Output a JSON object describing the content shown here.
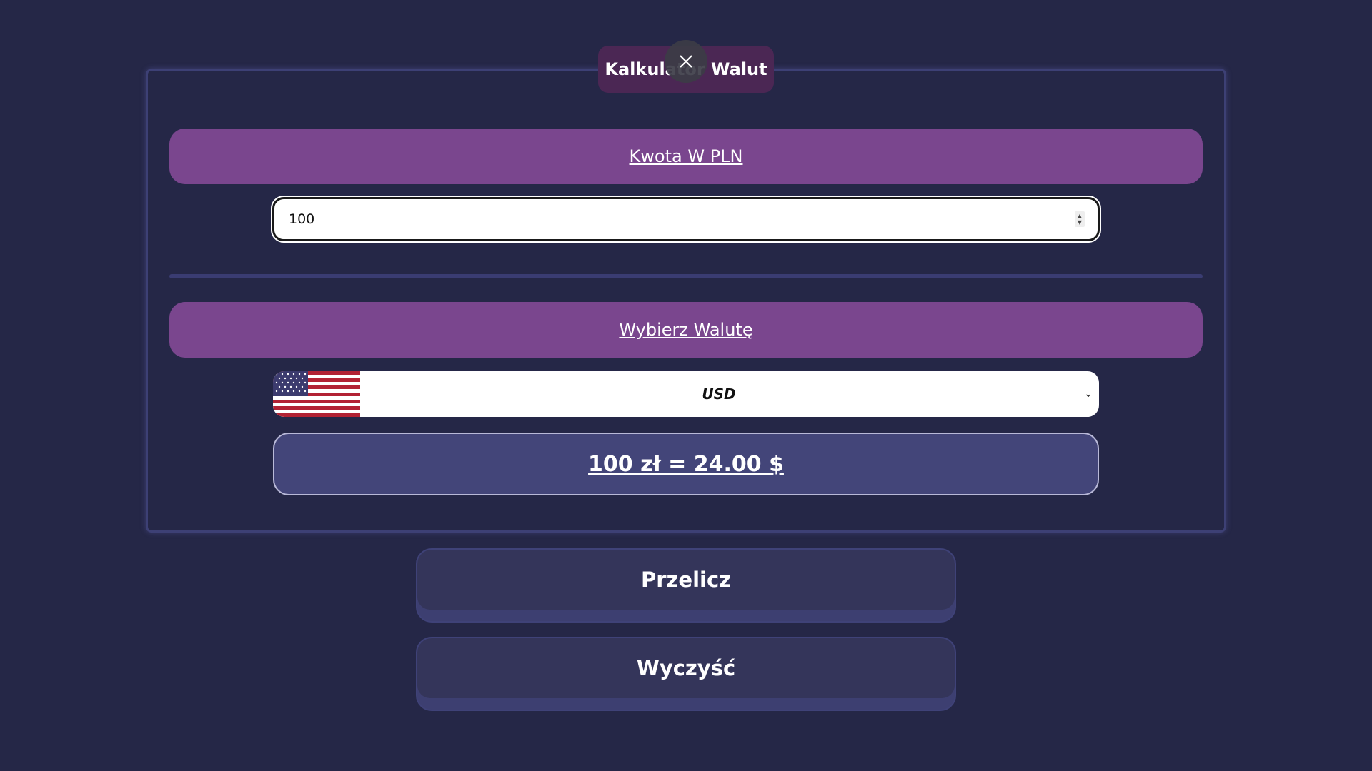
{
  "app": {
    "title": "Kalkulator Walut"
  },
  "amount_section": {
    "header": "Kwota W PLN",
    "input_value": "100"
  },
  "currency_section": {
    "header": "Wybierz Walutę",
    "selected": "USD",
    "flag": "us-flag-icon"
  },
  "result": {
    "text": "100 zł = 24.00 $"
  },
  "buttons": {
    "convert": "Przelicz",
    "clear": "Wyczyść"
  },
  "colors": {
    "background": "#252747",
    "accent": "#7a468e",
    "title_pill": "#4b2754",
    "result_box": "#434579"
  }
}
